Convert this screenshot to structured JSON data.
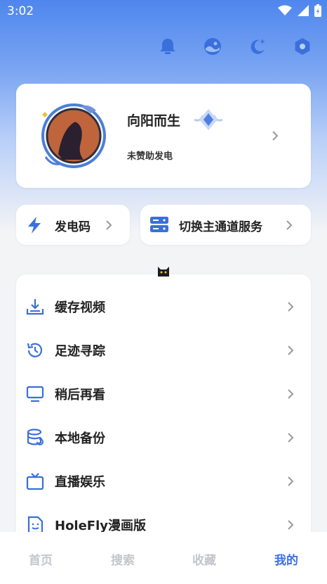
{
  "status_bar": {
    "time": "3:02"
  },
  "colors": {
    "accent": "#3d6fe3",
    "inactive_tab": "#c4c6cc"
  },
  "header_icons": [
    "bell-icon",
    "theme-icon",
    "night-mode-icon",
    "settings-icon"
  ],
  "profile": {
    "username": "向阳而生",
    "subtitle": "未赞助发电"
  },
  "quick_actions": {
    "charge_code": "发电码",
    "switch_channel": "切换主通道服务"
  },
  "menu": [
    {
      "label": "缓存视频",
      "icon": "download-icon"
    },
    {
      "label": "足迹寻踪",
      "icon": "history-icon"
    },
    {
      "label": "稍后再看",
      "icon": "monitor-icon"
    },
    {
      "label": "本地备份",
      "icon": "database-icon"
    },
    {
      "label": "直播娱乐",
      "icon": "tv-icon"
    },
    {
      "label": "HoleFly漫画版",
      "icon": "comic-icon"
    }
  ],
  "tabs": {
    "home": "首页",
    "search": "搜索",
    "favorites": "收藏",
    "mine": "我的",
    "active": "mine"
  }
}
